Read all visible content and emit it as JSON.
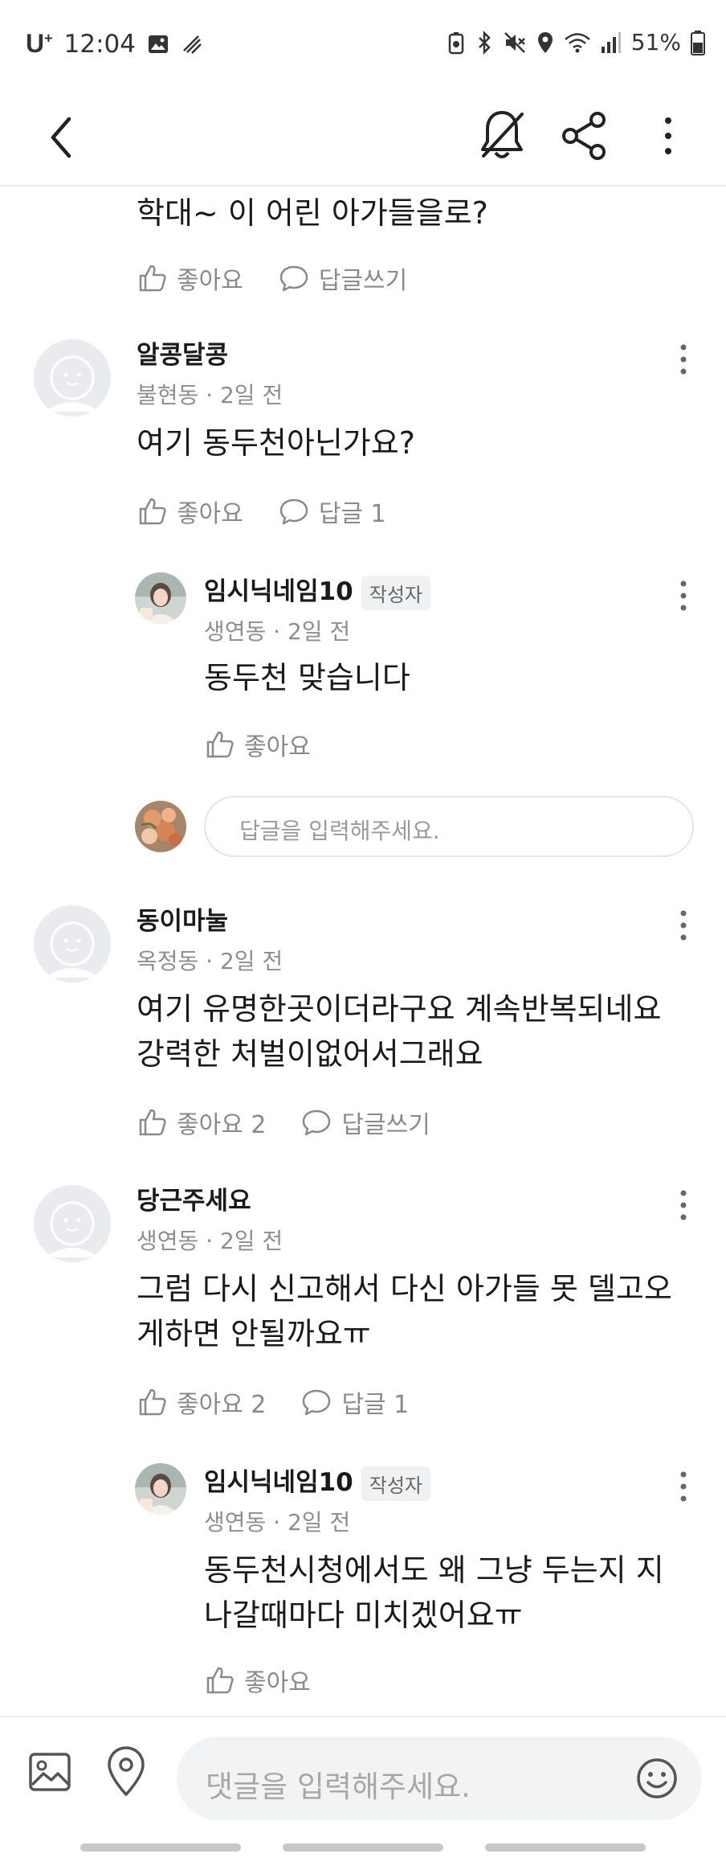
{
  "status": {
    "carrier": "U",
    "carrier_sup": "+",
    "time": "12:04",
    "battery": "51%"
  },
  "icons": {
    "back": "chevron-left-icon",
    "notification": "bell-off-icon",
    "share": "share-icon",
    "more": "more-vertical-icon",
    "like": "thumbs-up-icon",
    "reply": "chat-bubble-icon",
    "image": "image-icon",
    "location": "map-pin-icon",
    "emoji": "smile-icon"
  },
  "partial_comment": {
    "text": "학대~ 이 어린 아가들을로?",
    "like_label": "좋아요",
    "reply_label": "답글쓰기"
  },
  "comments": [
    {
      "name": "알콩달콩",
      "meta": "불현동 · 2일 전",
      "lines": [
        "여기 동두천아닌가요?"
      ],
      "like_label": "좋아요",
      "reply_label": "답글 1"
    },
    {
      "name": "임시닉네임10",
      "badge": "작성자",
      "meta": "생연동 · 2일 전",
      "lines": [
        "동두천 맞습니다"
      ],
      "like_label": "좋아요"
    },
    {
      "name": "동이마눌",
      "meta": "옥정동 · 2일 전",
      "lines": [
        "여기 유명한곳이더라구요 계속반복되네요",
        "강력한 처벌이없어서그래요"
      ],
      "like_label": "좋아요 2",
      "reply_label": "답글쓰기"
    },
    {
      "name": "당근주세요",
      "meta": "생연동 · 2일 전",
      "lines": [
        "그럼 다시 신고해서 다신 아가들 못 델고오",
        "게하면 안될까요ㅠ"
      ],
      "like_label": "좋아요 2",
      "reply_label": "답글 1"
    },
    {
      "name": "임시닉네임10",
      "badge": "작성자",
      "meta": "생연동 · 2일 전",
      "lines": [
        "동두천시청에서도 왜 그냥 두는지 지",
        "나갈때마다 미치겠어요ㅠ"
      ],
      "like_label": "좋아요"
    }
  ],
  "reply_input": {
    "placeholder": "답글을 입력해주세요."
  },
  "comment_input": {
    "placeholder": "댓글을 입력해주세요."
  },
  "colors": {
    "text": "#1a1a1a",
    "muted": "#8e8e8e",
    "divider": "#ececec",
    "input_bg": "#f2f3f5"
  }
}
